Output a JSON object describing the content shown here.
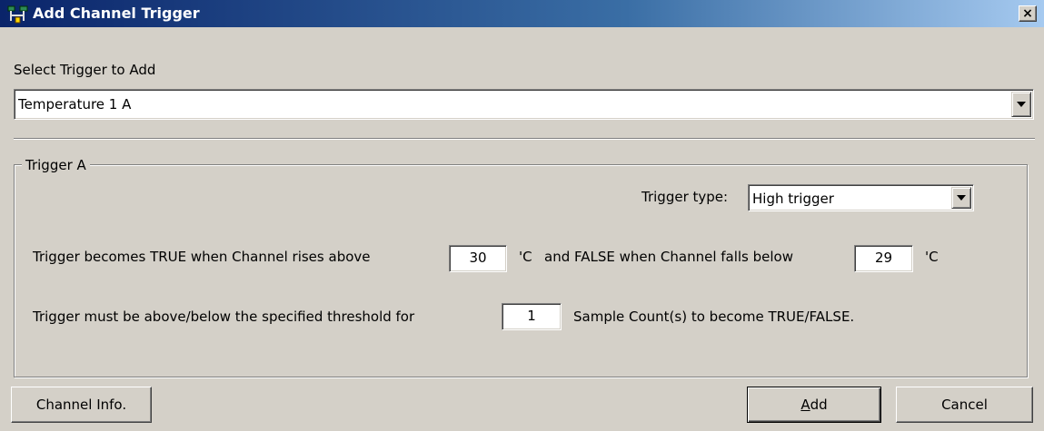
{
  "window": {
    "title": "Add Channel Trigger",
    "close_glyph": "×"
  },
  "select_trigger": {
    "label": "Select Trigger to Add",
    "value": "Temperature 1 A"
  },
  "trigger_group": {
    "legend": "Trigger A",
    "type_label": "Trigger type:",
    "type_value": "High trigger",
    "rise_text": "Trigger becomes TRUE when Channel rises above",
    "rise_value": "30",
    "unit_1": "'C",
    "fall_text": "and FALSE when Channel falls below",
    "fall_value": "29",
    "unit_2": "'C",
    "threshold_text": "Trigger must be above/below the specified threshold for",
    "sample_count": "1",
    "sample_text": "Sample Count(s) to become TRUE/FALSE."
  },
  "buttons": {
    "channel_info": "Channel Info.",
    "add_mnemonic": "A",
    "add_rest": "dd",
    "cancel": "Cancel"
  },
  "colors": {
    "title_gradient_start": "#0a246a",
    "title_gradient_end": "#a6caf0",
    "dialog_bg": "#d4d0c8"
  },
  "icons": {
    "app": "network-trigger-icon",
    "close": "close-icon",
    "dropdown": "triangle-down-icon"
  }
}
